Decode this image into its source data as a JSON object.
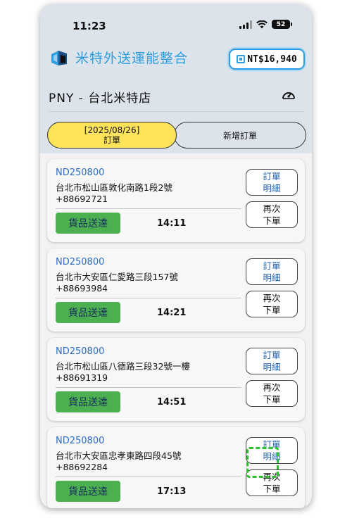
{
  "status_bar": {
    "time": "11:23",
    "battery": "52"
  },
  "header": {
    "app_title": "米特外送運能整合",
    "balance": "NT$16,940",
    "store_name": "PNY - 台北米特店"
  },
  "tabs": {
    "orders_date": "[2025/08/26]",
    "orders_label": "訂單",
    "new_order_label": "新增訂單"
  },
  "order_actions": {
    "deliver_label": "貨品送達",
    "detail_line1": "訂單",
    "detail_line2": "明細",
    "reorder_line1": "再次",
    "reorder_line2": "下單"
  },
  "orders": [
    {
      "id": "ND250800",
      "address": "台北市松山區敦化南路1段2號",
      "phone": "+88692721",
      "time": "14:11"
    },
    {
      "id": "ND250800",
      "address": "台北市大安區仁愛路三段157號",
      "phone": "+88693984",
      "time": "14:21"
    },
    {
      "id": "ND250800",
      "address": "台北市松山區八德路三段32號一樓",
      "phone": "+88691319",
      "time": "14:51"
    },
    {
      "id": "ND250800",
      "address": "台北市大安區忠孝東路四段45號",
      "phone": "+88692284",
      "time": "17:13"
    }
  ],
  "colors": {
    "accent": "#2d9ee0",
    "deliver_green": "#4caf50",
    "tab_active": "#ffe45a",
    "order_id": "#2d6bc0"
  }
}
